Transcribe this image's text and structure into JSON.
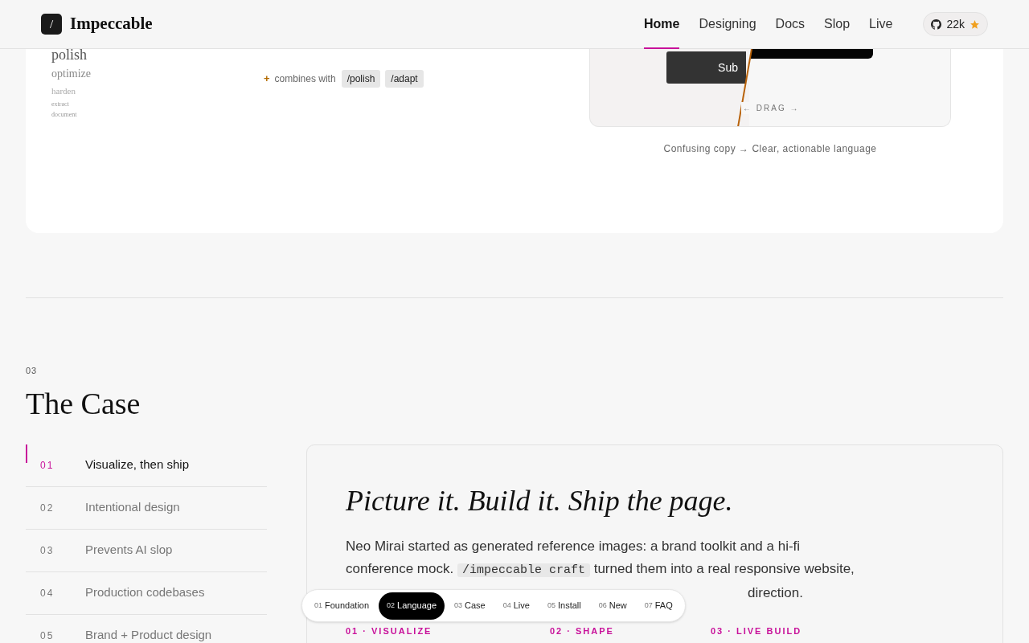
{
  "header": {
    "logo_mark": "/",
    "brand": "Impeccable",
    "nav": [
      {
        "label": "Home",
        "selected": true
      },
      {
        "label": "Designing",
        "selected": false
      },
      {
        "label": "Docs",
        "selected": false
      },
      {
        "label": "Slop",
        "selected": false
      },
      {
        "label": "Live",
        "selected": false
      }
    ],
    "github": {
      "stars": "22k"
    }
  },
  "commands": {
    "words": [
      "polish",
      "optimize",
      "harden",
      "extract",
      "document"
    ]
  },
  "combines": {
    "plus": "+",
    "label": "combines with",
    "tags": [
      "/polish",
      "/adapt"
    ]
  },
  "compare": {
    "level": 0.44,
    "button_label": "Sub",
    "drag_label": "← DRAG →",
    "caption": "Confusing copy → Clear, actionable language"
  },
  "section": {
    "number": "03",
    "title": "The Case",
    "items": [
      {
        "number": "01",
        "label": "Visualize, then ship",
        "selected": true
      },
      {
        "number": "02",
        "label": "Intentional design",
        "selected": false
      },
      {
        "number": "03",
        "label": "Prevents AI slop",
        "selected": false
      },
      {
        "number": "04",
        "label": "Production codebases",
        "selected": false
      },
      {
        "number": "05",
        "label": "Brand + Product design",
        "selected": false
      }
    ]
  },
  "card": {
    "title": "Picture it. Build it. Ship the page.",
    "paragraph_before": "Neo Mirai started as generated reference images: a brand toolkit and a hi-fi conference mock.",
    "code": "/impeccable craft",
    "paragraph_after": "turned them into a real responsive website,",
    "paragraph_tail": "direction.",
    "steps": [
      "01 · VISUALIZE",
      "02 · SHAPE",
      "03 · LIVE BUILD"
    ]
  },
  "bottom_nav": [
    {
      "number": "01",
      "label": "Foundation",
      "selected": false
    },
    {
      "number": "02",
      "label": "Language",
      "selected": true
    },
    {
      "number": "03",
      "label": "Case",
      "selected": false
    },
    {
      "number": "04",
      "label": "Live",
      "selected": false
    },
    {
      "number": "05",
      "label": "Install",
      "selected": false
    },
    {
      "number": "06",
      "label": "New",
      "selected": false
    },
    {
      "number": "07",
      "label": "FAQ",
      "selected": false
    }
  ]
}
